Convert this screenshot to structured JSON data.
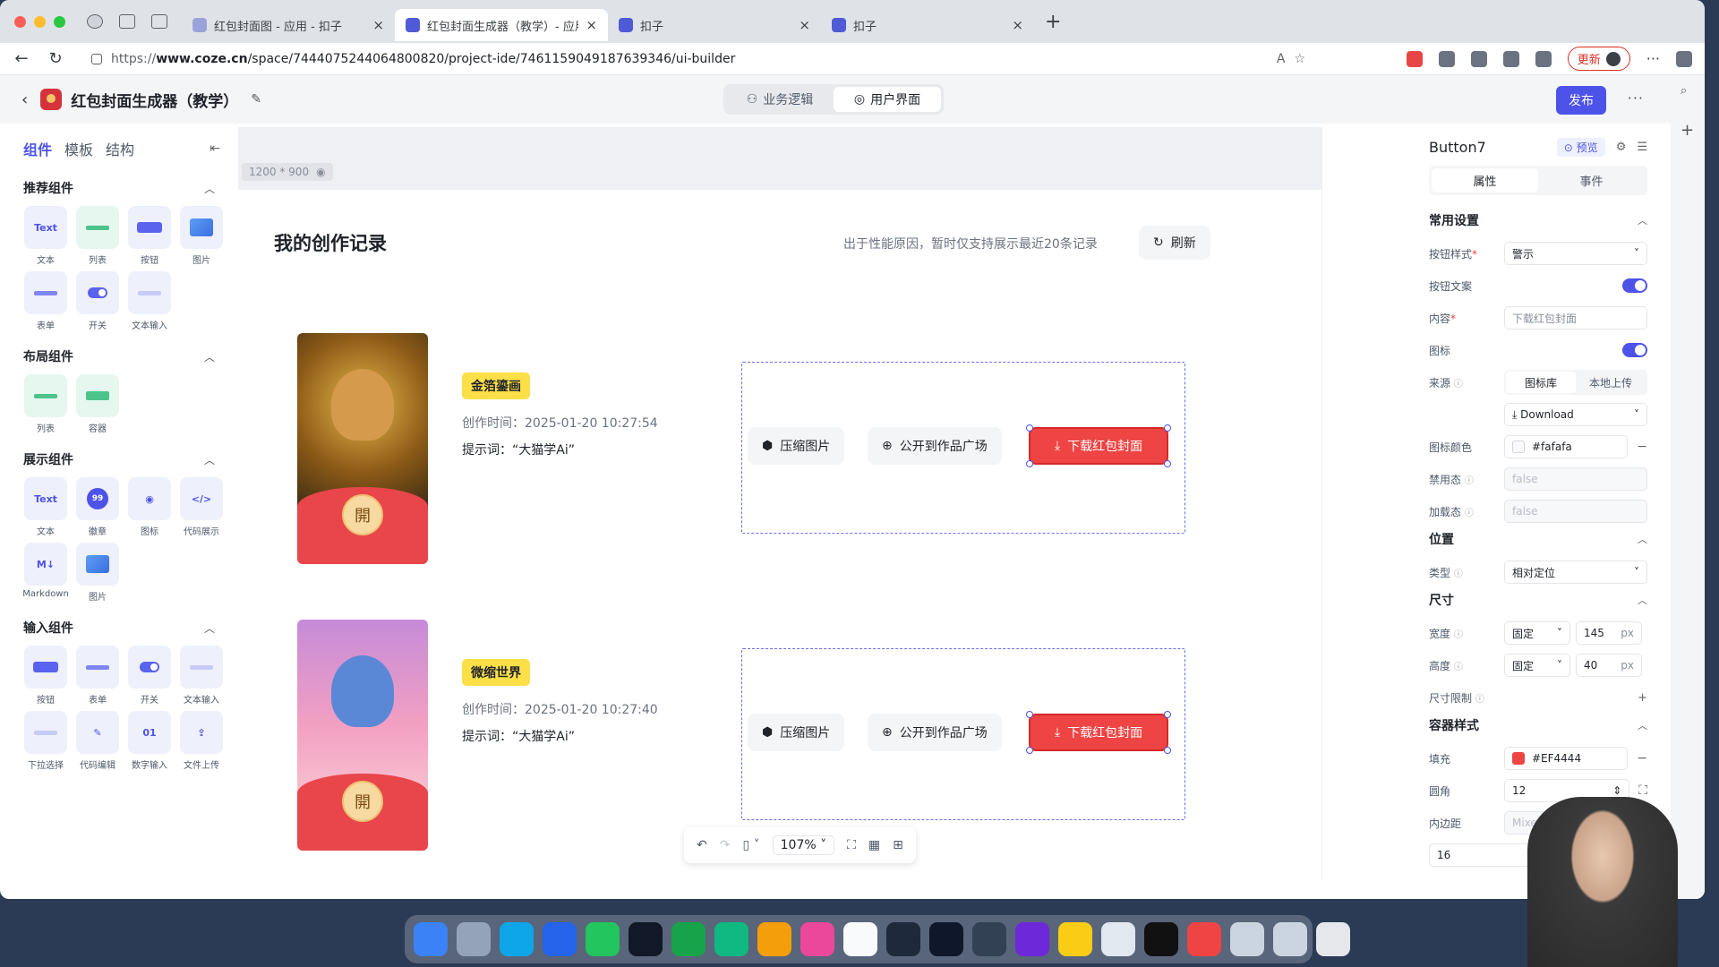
{
  "browser": {
    "tabs": [
      {
        "title": "红包封面图 - 应用 - 扣子",
        "active": false
      },
      {
        "title": "红包封面生成器（教学）- 应用 -",
        "active": true
      },
      {
        "title": "扣子",
        "active": false
      },
      {
        "title": "扣子",
        "active": false
      }
    ],
    "url_prefix": "https://",
    "url_host": "www.coze.cn",
    "url_path": "/space/7444075244064800820/project-ide/7461159049187639346/ui-builder",
    "update_label": "更新"
  },
  "app": {
    "title": "红包封面生成器（教学）",
    "mode_tabs": [
      {
        "label": "业务逻辑",
        "active": false
      },
      {
        "label": "用户界面",
        "active": true
      }
    ],
    "publish_label": "发布"
  },
  "left_panel": {
    "tabs": [
      {
        "label": "组件",
        "active": true
      },
      {
        "label": "模板",
        "active": false
      },
      {
        "label": "结构",
        "active": false
      }
    ],
    "sections": [
      {
        "title": "推荐组件",
        "items": [
          "文本",
          "列表",
          "按钮",
          "图片",
          "表单",
          "开关",
          "文本输入"
        ]
      },
      {
        "title": "布局组件",
        "items": [
          "列表",
          "容器"
        ]
      },
      {
        "title": "展示组件",
        "items": [
          "文本",
          "徽章",
          "图标",
          "代码展示",
          "Markdown",
          "图片"
        ]
      },
      {
        "title": "输入组件",
        "items": [
          "按钮",
          "表单",
          "开关",
          "文本输入",
          "下拉选择",
          "代码编辑",
          "数字输入",
          "文件上传"
        ]
      }
    ]
  },
  "canvas": {
    "size_label": "1200 * 900",
    "page_title": "我的创作记录",
    "note": "出于性能原因，暂时仅支持展示最近20条记录",
    "refresh_label": "刷新",
    "cover_seal": "開",
    "records": [
      {
        "tag": "金箔鎏画",
        "time": "创作时间：2025-01-20 10:27:54",
        "prompt": "提示词：“大猫学Ai”"
      },
      {
        "tag": "微缩世界",
        "time": "创作时间：2025-01-20 10:27:40",
        "prompt": "提示词：“大猫学Ai”"
      }
    ],
    "actions": {
      "compress": "压缩图片",
      "publish_square": "公开到作品广场",
      "download": "下载红包封面"
    },
    "zoom": "107%"
  },
  "right_panel": {
    "component_name": "Button7",
    "preview_label": "预览",
    "tabs": [
      {
        "label": "属性",
        "active": true
      },
      {
        "label": "事件",
        "active": false
      }
    ],
    "common": {
      "title": "常用设置",
      "button_style_label": "按钮样式",
      "button_style_value": "警示",
      "button_text_label": "按钮文案",
      "content_label": "内容",
      "content_value": "下载红包封面",
      "icon_label": "图标",
      "source_label": "来源",
      "source_options": [
        "图标库",
        "本地上传"
      ],
      "icon_value": "Download",
      "icon_color_label": "图标颜色",
      "icon_color_value": "#fafafa",
      "disabled_label": "禁用态",
      "disabled_value": "false",
      "loading_label": "加载态",
      "loading_value": "false"
    },
    "position": {
      "title": "位置",
      "type_label": "类型",
      "type_value": "相对定位"
    },
    "size": {
      "title": "尺寸",
      "width_label": "宽度",
      "width_mode": "固定",
      "width_value": "145",
      "height_label": "高度",
      "height_mode": "固定",
      "height_value": "40",
      "unit": "px",
      "limit_label": "尺寸限制"
    },
    "container": {
      "title": "容器样式",
      "fill_label": "填充",
      "fill_value": "#EF4444",
      "radius_label": "圆角",
      "radius_value": "12",
      "padding_label": "内边距",
      "padding_value": "Mixed",
      "bottom_value": "16"
    }
  },
  "colors": {
    "accent": "#4d53e8",
    "danger": "#ef4444",
    "tag_yellow": "#fde047"
  }
}
